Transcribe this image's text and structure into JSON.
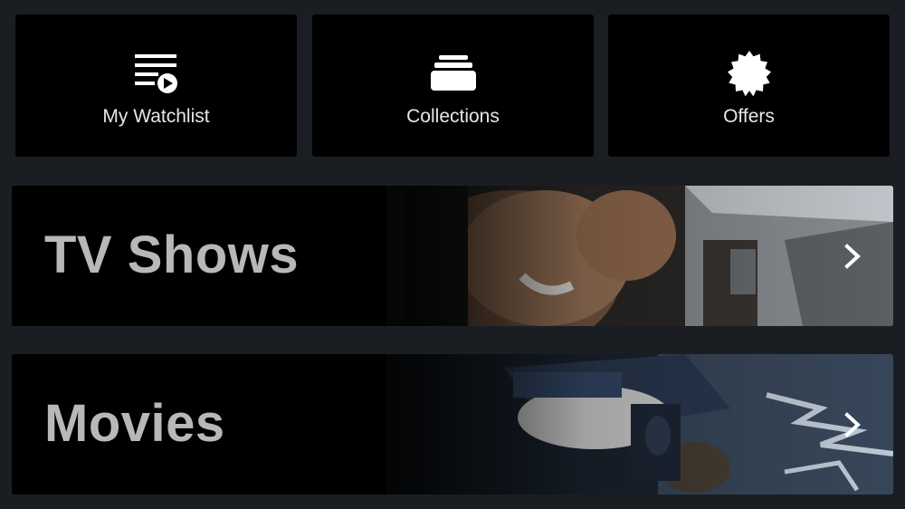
{
  "quick_tiles": [
    {
      "label": "My Watchlist",
      "icon": "watchlist-icon"
    },
    {
      "label": "Collections",
      "icon": "collections-icon"
    },
    {
      "label": "Offers",
      "icon": "offers-badge-icon"
    }
  ],
  "categories": [
    {
      "title": "TV Shows",
      "icon": "chevron-right-icon",
      "artwork": "man-laughing-in-car"
    },
    {
      "title": "Movies",
      "icon": "chevron-right-icon",
      "artwork": "man-falling-action-scene"
    }
  ],
  "colors": {
    "background": "#1a1e23",
    "tile": "#000000",
    "tile_label": "#e6e6e6",
    "banner_title": "#b8b8b8",
    "chevron": "#ffffff"
  }
}
